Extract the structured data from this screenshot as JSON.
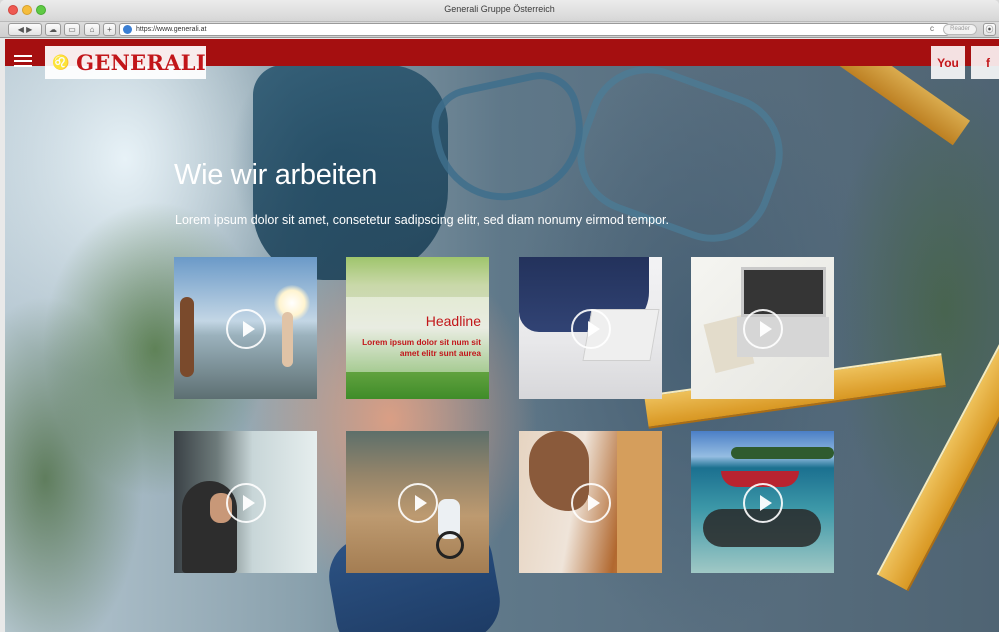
{
  "browser": {
    "window_title": "Generali Gruppe Österreich",
    "url": "https://www.generali.at",
    "reader_label": "Reader"
  },
  "header": {
    "logo_text": "GENERALI",
    "social": {
      "youtube_label": "You",
      "facebook_label": "f"
    }
  },
  "main": {
    "title": "Wie wir arbeiten",
    "subtitle": "Lorem ipsum dolor sit amet, consetetur sadipscing elitr, sed diam nonumy eirmod tempor."
  },
  "tiles": [
    {
      "name": "beach",
      "play_icon": "play-circle-icon"
    },
    {
      "name": "headline",
      "headline": "Headline",
      "text": "Lorem ipsum dolor sit num sit amet elitr sunt aurea"
    },
    {
      "name": "laptop-meeting",
      "play_icon": "play-circle-icon"
    },
    {
      "name": "desk-laptop",
      "play_icon": "play-circle-icon"
    },
    {
      "name": "office-window",
      "play_icon": "play-circle-icon"
    },
    {
      "name": "mountain-bike",
      "play_icon": "play-circle-icon"
    },
    {
      "name": "painting",
      "play_icon": "play-circle-icon"
    },
    {
      "name": "lake-canoe",
      "play_icon": "play-circle-icon"
    }
  ],
  "colors": {
    "brand_red": "#a50f10",
    "logo_red": "#c2161a"
  }
}
